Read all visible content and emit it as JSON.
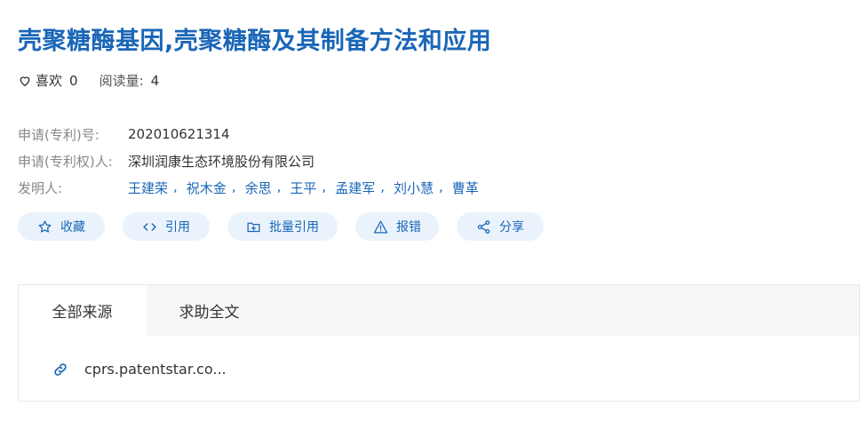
{
  "title": "壳聚糖酶基因,壳聚糖酶及其制备方法和应用",
  "stats": {
    "likes_label": "喜欢",
    "likes_count": "0",
    "reads_label": "阅读量:",
    "reads_count": "4"
  },
  "meta": {
    "application_number_label": "申请(专利)号:",
    "application_number": "202010621314",
    "applicant_label": "申请(专利权)人:",
    "applicant": "深圳润康生态环境股份有限公司",
    "inventors_label": "发明人:",
    "inventors": [
      "王建荣",
      "祝木金",
      "余思",
      "王平",
      "孟建军",
      "刘小慧",
      "曹革"
    ],
    "inventor_separator": ","
  },
  "actions": {
    "collect": "收藏",
    "cite": "引用",
    "batch_cite": "批量引用",
    "report": "报错",
    "share": "分享"
  },
  "tabs": {
    "all_sources": "全部来源",
    "request_fulltext": "求助全文"
  },
  "source": {
    "link_text": "cprs.patentstar.co..."
  },
  "colors": {
    "accent": "#1a66b8",
    "pill_bg": "#eaf3fc",
    "label_gray": "#888888",
    "tabbar_bg": "#f7f7f7"
  }
}
